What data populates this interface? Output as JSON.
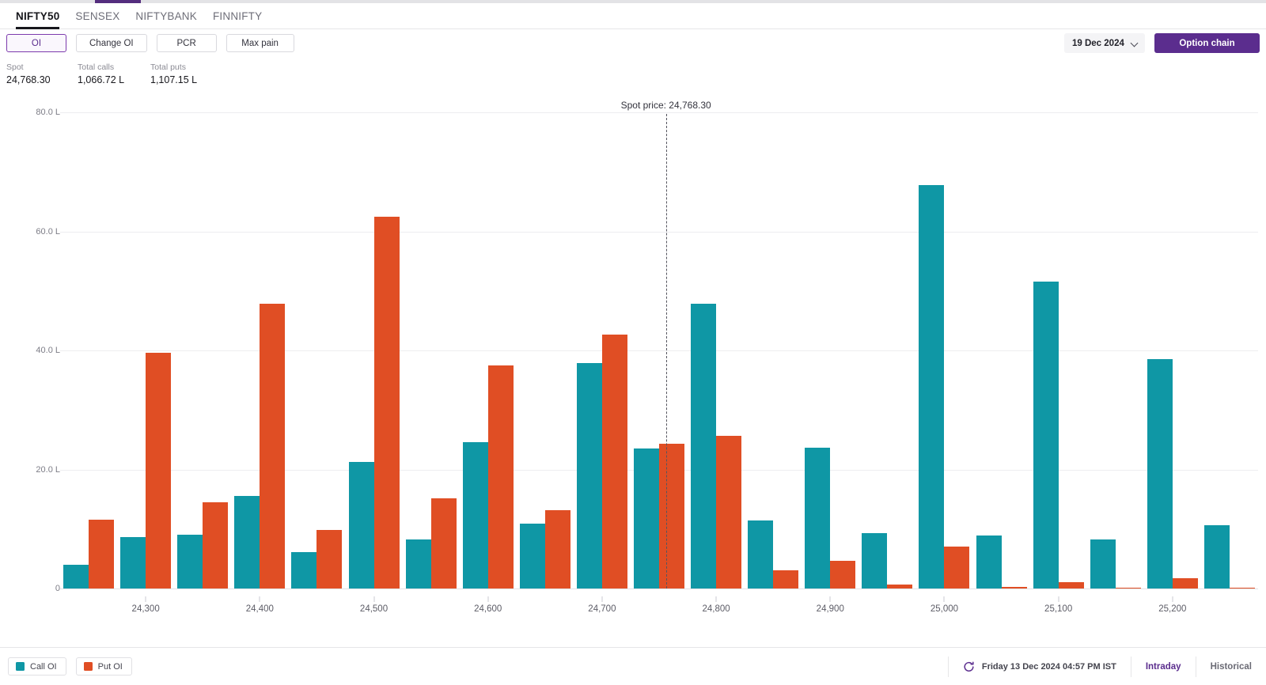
{
  "top_indicator": {
    "color": "#542d7e"
  },
  "tabs": [
    {
      "label": "NIFTY50",
      "active": true
    },
    {
      "label": "SENSEX",
      "active": false
    },
    {
      "label": "NIFTYBANK",
      "active": false
    },
    {
      "label": "FINNIFTY",
      "active": false
    }
  ],
  "metric_buttons": [
    {
      "label": "OI",
      "selected": true
    },
    {
      "label": "Change OI",
      "selected": false
    },
    {
      "label": "PCR",
      "selected": false
    },
    {
      "label": "Max pain",
      "selected": false
    }
  ],
  "expiry": {
    "value": "19 Dec 2024",
    "icon": "chevron-down-icon"
  },
  "option_chain_button": {
    "label": "Option chain",
    "color": "#5b2d8e"
  },
  "stats": [
    {
      "label": "Spot",
      "value": "24,768.30"
    },
    {
      "label": "Total calls",
      "value": "1,066.72 L"
    },
    {
      "label": "Total puts",
      "value": "1,107.15 L"
    }
  ],
  "legend": [
    {
      "label": "Call OI",
      "color": "#0f97a5"
    },
    {
      "label": "Put OI",
      "color": "#e04e24"
    }
  ],
  "footer": {
    "refresh_icon": "refresh-icon",
    "timestamp": "Friday 13 Dec 2024 04:57 PM IST",
    "modes": [
      {
        "label": "Intraday",
        "active": true
      },
      {
        "label": "Historical",
        "active": false
      }
    ]
  },
  "chart_data": {
    "type": "bar",
    "title": "",
    "xlabel": "",
    "ylabel": "",
    "ylim": [
      0,
      80
    ],
    "yticks": [
      0,
      20,
      40,
      60,
      80
    ],
    "ytick_labels": [
      "0",
      "20.0 L",
      "40.0 L",
      "60.0 L",
      "80.0 L"
    ],
    "grid": true,
    "legend_position": "bottom-left",
    "unit": "L",
    "categories": [
      "24,250",
      "24,300",
      "24,350",
      "24,400",
      "24,450",
      "24,500",
      "24,550",
      "24,600",
      "24,650",
      "24,700",
      "24,750",
      "24,800",
      "24,850",
      "24,900",
      "24,950",
      "25,000",
      "25,050",
      "25,100",
      "25,150",
      "25,200",
      "25,250"
    ],
    "xtick_labels": [
      "",
      "24,300",
      "",
      "24,400",
      "",
      "24,500",
      "",
      "24,600",
      "",
      "24,700",
      "",
      "24,800",
      "",
      "24,900",
      "",
      "25,000",
      "",
      "25,100",
      "",
      "25,200",
      ""
    ],
    "series": [
      {
        "name": "Call OI",
        "color": "#0f97a5",
        "values": [
          4.0,
          8.7,
          9.0,
          15.5,
          6.1,
          21.3,
          8.2,
          24.6,
          10.9,
          37.9,
          23.5,
          47.8,
          11.4,
          23.6,
          9.3,
          67.8,
          8.9,
          51.5,
          8.3,
          38.6,
          10.6
        ]
      },
      {
        "name": "Put OI",
        "color": "#e04e24",
        "values": [
          11.6,
          39.6,
          14.5,
          47.8,
          9.8,
          62.5,
          15.1,
          37.5,
          13.1,
          42.6,
          24.3,
          25.6,
          3.1,
          4.7,
          0.7,
          7.0,
          0.3,
          1.1,
          0.2,
          1.7,
          0.15
        ]
      }
    ],
    "annotation": {
      "label": "Spot price: 24,768.30",
      "value": 24768.3,
      "category_index": 10,
      "style": "dashed-vertical-line"
    }
  }
}
